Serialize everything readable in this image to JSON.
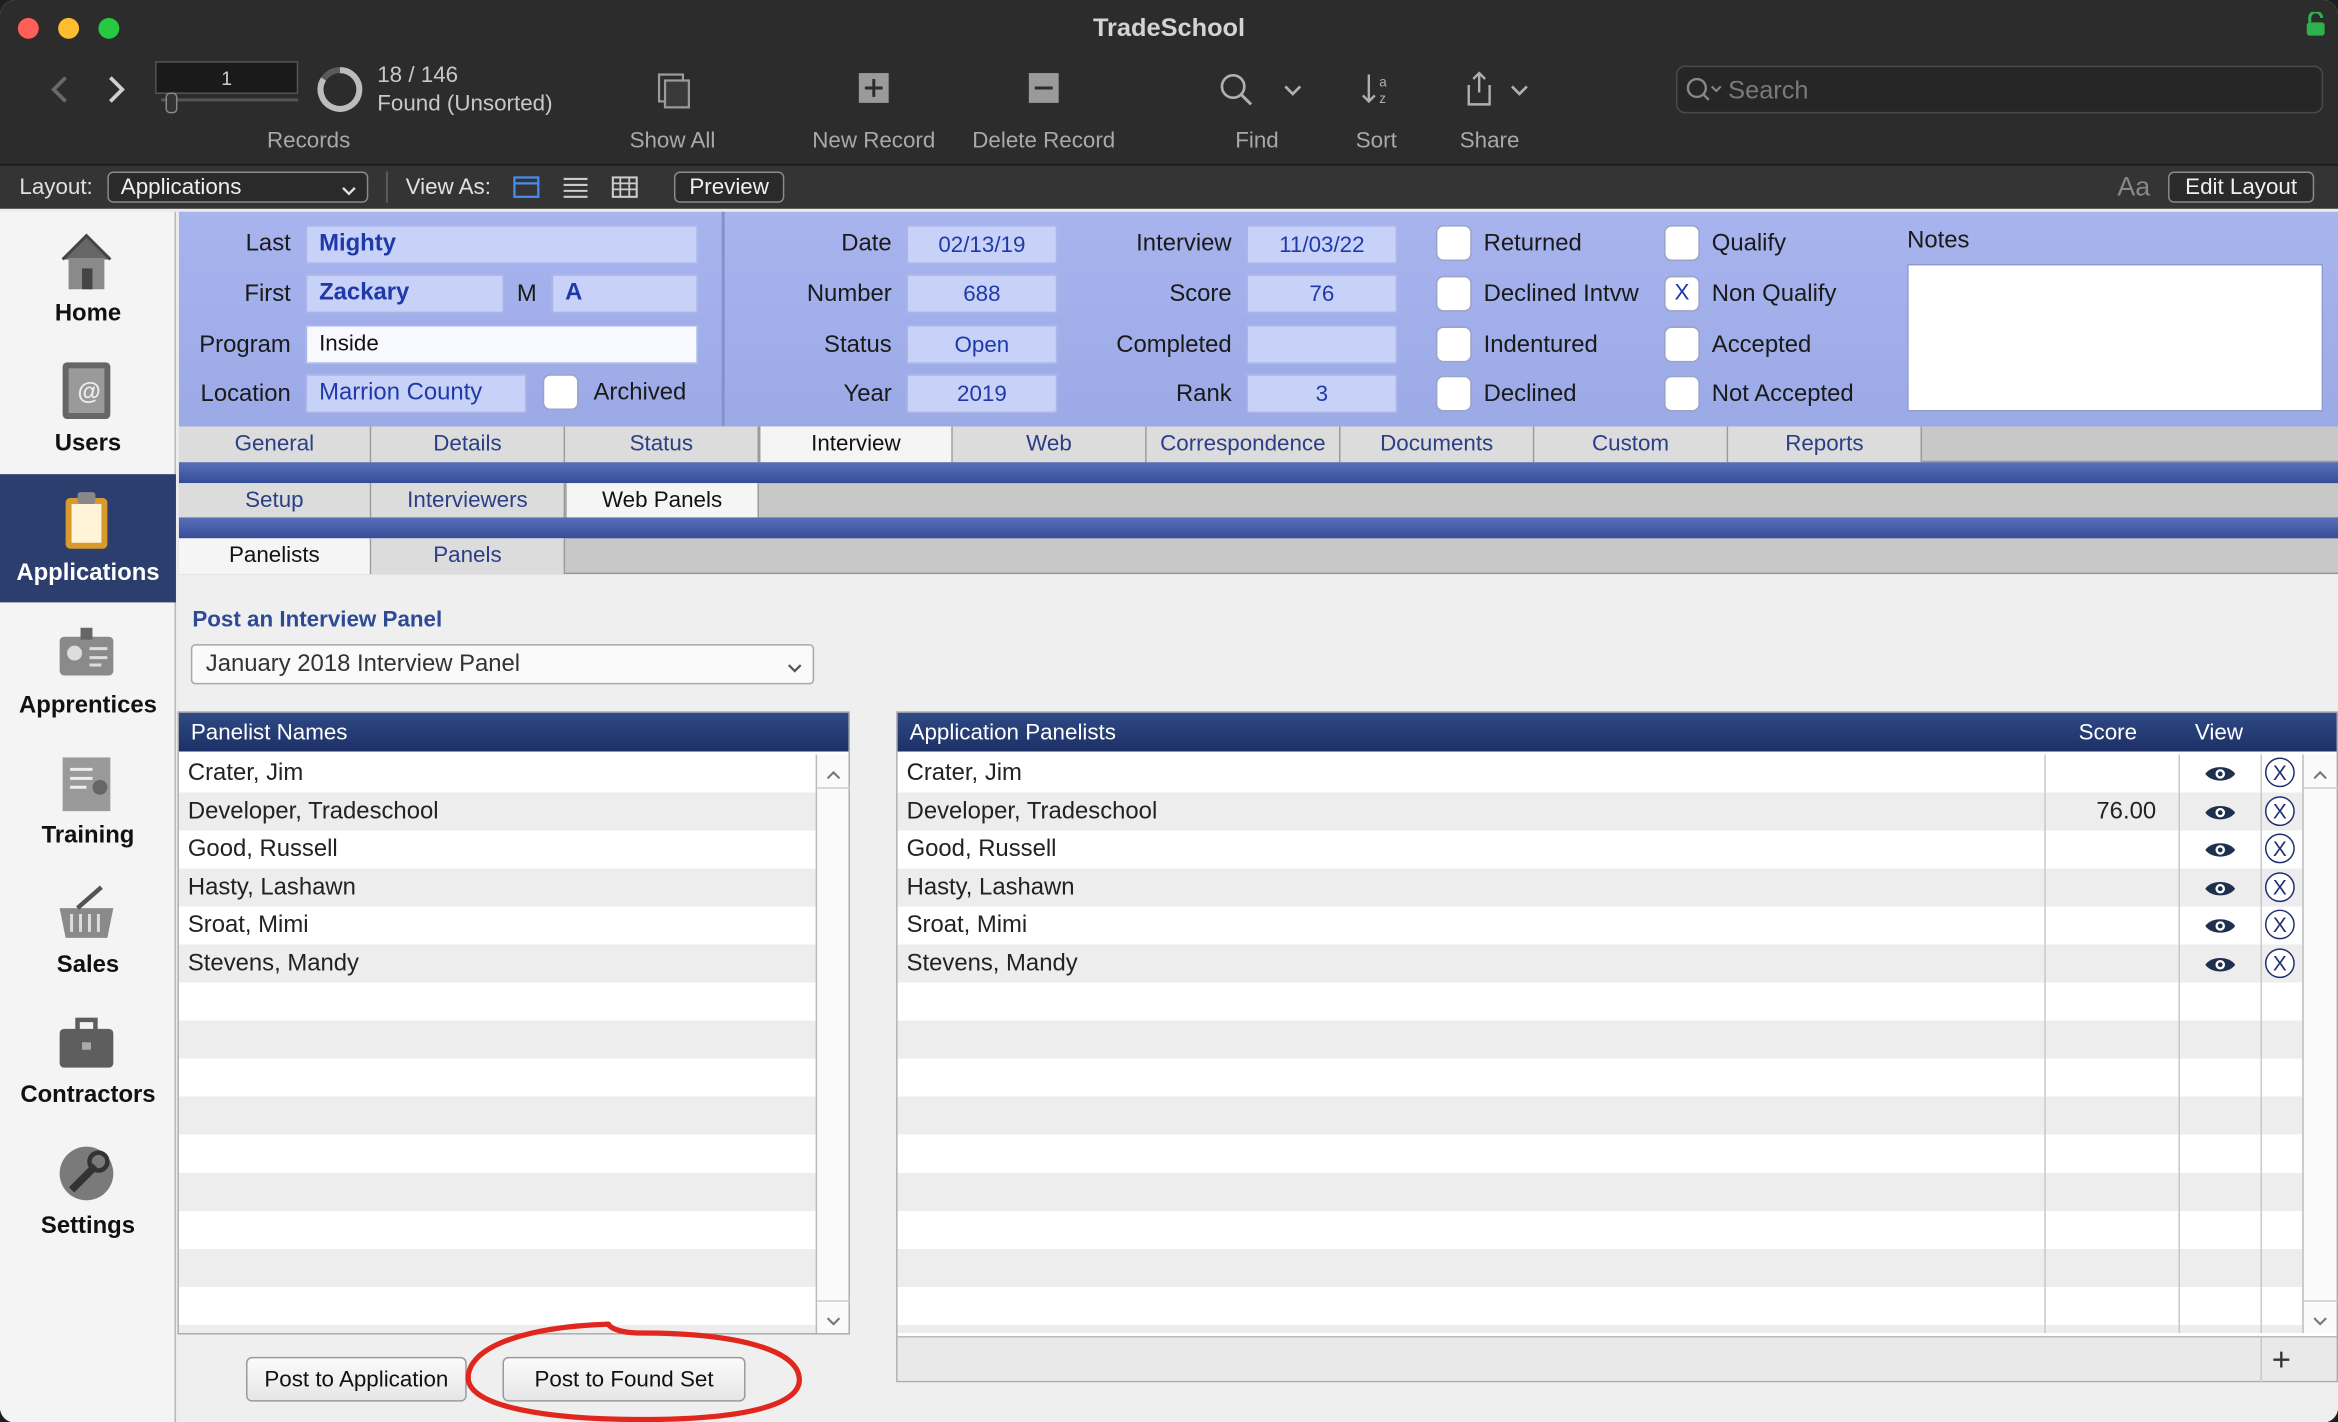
{
  "window": {
    "title": "TradeSchool"
  },
  "toolbar": {
    "record_input": "1",
    "record_count": "18 / 146",
    "found_status": "Found (Unsorted)",
    "records_label": "Records",
    "show_all_label": "Show All",
    "new_record_label": "New Record",
    "delete_record_label": "Delete Record",
    "find_label": "Find",
    "sort_label": "Sort",
    "share_label": "Share",
    "search_placeholder": "Search"
  },
  "layout_bar": {
    "layout_label": "Layout:",
    "layout_value": "Applications",
    "view_as_label": "View As:",
    "preview_label": "Preview",
    "font_icon_text": "Aa",
    "edit_layout_label": "Edit Layout"
  },
  "sidebar": {
    "items": [
      {
        "label": "Home"
      },
      {
        "label": "Users"
      },
      {
        "label": "Applications"
      },
      {
        "label": "Apprentices"
      },
      {
        "label": "Training"
      },
      {
        "label": "Sales"
      },
      {
        "label": "Contractors"
      },
      {
        "label": "Settings"
      }
    ]
  },
  "record": {
    "last_label": "Last",
    "last": "Mighty",
    "first_label": "First",
    "first": "Zackary",
    "middle_label": "M",
    "middle": "A",
    "program_label": "Program",
    "program": "Inside",
    "location_label": "Location",
    "location": "Marrion County",
    "archived_label": "Archived",
    "date_label": "Date",
    "date": "02/13/19",
    "number_label": "Number",
    "number": "688",
    "status_label": "Status",
    "status": "Open",
    "year_label": "Year",
    "year": "2019",
    "interview_label": "Interview",
    "interview": "11/03/22",
    "score_label": "Score",
    "score": "76",
    "completed_label": "Completed",
    "completed": "",
    "rank_label": "Rank",
    "rank": "3",
    "notes_label": "Notes",
    "checks": {
      "returned": {
        "label": "Returned",
        "mark": ""
      },
      "declined_intvw": {
        "label": "Declined Intvw",
        "mark": ""
      },
      "indentured": {
        "label": "Indentured",
        "mark": ""
      },
      "declined": {
        "label": "Declined",
        "mark": ""
      },
      "qualify": {
        "label": "Qualify",
        "mark": ""
      },
      "non_qualify": {
        "label": "Non Qualify",
        "mark": "X"
      },
      "accepted": {
        "label": "Accepted",
        "mark": ""
      },
      "not_accepted": {
        "label": "Not Accepted",
        "mark": ""
      }
    }
  },
  "tabs": {
    "main": [
      "General",
      "Details",
      "Status",
      "Interview",
      "Web",
      "Correspondence",
      "Documents",
      "Custom",
      "Reports"
    ],
    "sub": [
      "Setup",
      "Interviewers",
      "Web Panels"
    ],
    "subsub": [
      "Panelists",
      "Panels"
    ]
  },
  "panel": {
    "heading": "Post an Interview Panel",
    "selected": "January 2018 Interview Panel"
  },
  "panelist_names": {
    "header": "Panelist Names",
    "rows": [
      "Crater, Jim",
      "Developer, Tradeschool",
      "Good, Russell",
      "Hasty, Lashawn",
      "Sroat, Mimi",
      "Stevens, Mandy"
    ]
  },
  "application_panelists": {
    "header": "Application Panelists",
    "score_header": "Score",
    "view_header": "View",
    "rows": [
      {
        "name": "Crater, Jim",
        "score": ""
      },
      {
        "name": "Developer, Tradeschool",
        "score": "76.00"
      },
      {
        "name": "Good, Russell",
        "score": ""
      },
      {
        "name": "Hasty, Lashawn",
        "score": ""
      },
      {
        "name": "Sroat, Mimi",
        "score": ""
      },
      {
        "name": "Stevens, Mandy",
        "score": ""
      }
    ],
    "remove_mark": "X",
    "add_label": "+"
  },
  "buttons": {
    "post_to_application": "Post to Application",
    "post_to_found_set": "Post to Found Set"
  },
  "colors": {
    "annotation": "#e0271e",
    "header_blue": "#a7b4ee",
    "list_header": "#1d3066"
  }
}
